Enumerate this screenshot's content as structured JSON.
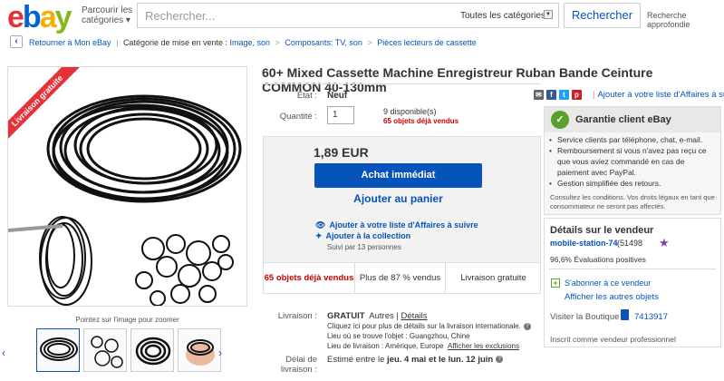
{
  "header": {
    "logo_letters": [
      "e",
      "b",
      "a",
      "y"
    ],
    "browse_line1": "Parcourir les",
    "browse_line2": "catégories",
    "search_placeholder": "Rechercher...",
    "category_select": "Toutes les catégories",
    "search_button": "Rechercher",
    "advanced_search": "Recherche approfondie"
  },
  "breadcrumb": {
    "back": "Retourner à Mon eBay",
    "category_label": "Catégorie de mise en vente :",
    "items": [
      "Image, son",
      "Composants: TV, son",
      "Pièces lecteurs de cassette"
    ],
    "separator": ">"
  },
  "gallery": {
    "ribbon": "Livraison gratuite",
    "zoom_hint": "Pointez sur l'image pour zoomer",
    "thumb_count": 4
  },
  "listing": {
    "title": "60+ Mixed Cassette Machine Enregistreur Ruban Bande Ceinture COMMON 40-130mm",
    "condition_label": "État :",
    "condition_value": "Neuf",
    "quantity_label": "Quantité :",
    "quantity_value": "1",
    "available": "9 disponible(s)",
    "sold": "65 objets déjà vendus",
    "price": "1,89 EUR",
    "buy_now": "Achat immédiat",
    "add_to_cart": "Ajouter au panier",
    "add_watch": "Ajouter à votre liste d'Affaires à suivre",
    "add_collection": "Ajouter à la collection",
    "followers": "Suivi par 13 personnes",
    "stats": {
      "sold": "65 objets déjà vendus",
      "percent": "Plus de 87 % vendus",
      "free_ship": "Livraison gratuite"
    },
    "shipping": {
      "label": "Livraison :",
      "price": "GRATUIT",
      "service": "Autres",
      "details": "Détails",
      "intl": "Cliquez ici pour plus de détails sur la livraison internationale.",
      "location": "Lieu où se trouve l'objet : Guangzhou, Chine",
      "place": "Lieu de livraison : Amérique, Europe",
      "exclusions": "Afficher les exclusions"
    },
    "delivery": {
      "label_line1": "Délai de",
      "label_line2": "livraison :",
      "text_prefix": "Estimé entre le",
      "date_range": "jeu. 4 mai et le lun. 12 juin"
    }
  },
  "right": {
    "add_watch": "Ajouter à votre liste d'Affaires à suivre",
    "share_icons": [
      "email-icon",
      "facebook-icon",
      "twitter-icon",
      "pinterest-icon"
    ],
    "guarantee": {
      "title": "Garantie client eBay",
      "items": [
        "Service clients par téléphone, chat, e-mail.",
        "Remboursement si vous n'avez pas reçu ce que vous aviez commandé en cas de paiement avec PayPal.",
        "Gestion simplifiée des retours."
      ],
      "legal": "Consultez les conditions. Vos droits légaux en tant que consommateur ne seront pas affectés."
    },
    "seller": {
      "title": "Détails sur le vendeur",
      "name": "mobile-station-74",
      "score": "(51498",
      "positive": "96,6% Évaluations positives",
      "subscribe": "S'abonner à ce vendeur",
      "other_items": "Afficher les autres objets",
      "shop_label": "Visiter la Boutique :",
      "shop_id": "7413917",
      "pro": "Inscrit comme vendeur professionnel"
    }
  },
  "colors": {
    "ebay_red": "#e53238",
    "ebay_blue": "#0064d2",
    "ebay_yellow": "#f5af02",
    "ebay_green": "#86b817",
    "link": "#0654ba",
    "sold_red": "#cc0000"
  }
}
